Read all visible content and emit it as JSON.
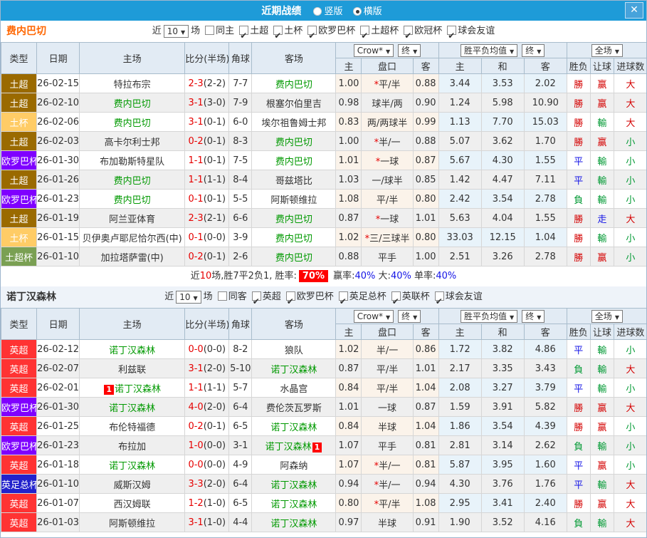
{
  "titlebar": {
    "title": "近期战绩",
    "radio_vertical": "竖版",
    "radio_horizontal": "横版",
    "close": "✕"
  },
  "col_headers": {
    "type": "类型",
    "date": "日期",
    "home": "主场",
    "score": "比分(半场)",
    "corner": "角球",
    "away": "客场",
    "crow": "Crow*",
    "final": "终",
    "avg": "胜平负均值",
    "full": "全场",
    "h": "主",
    "handicap": "盘口",
    "a": "客",
    "avg_h": "主",
    "avg_d": "和",
    "avg_a": "客",
    "wdl": "胜负",
    "let_ball": "让球",
    "goals": "进球数"
  },
  "type_colors": {
    "土超": "#9A6A00",
    "土杯": "#FFCC66",
    "欧罗巴杯": "#7F00FF",
    "土超杯": "#7AA053",
    "英超": "#FF3333",
    "英足总杯": "#2222CC"
  },
  "result_colors": {
    "勝": "red",
    "赢": "red",
    "大": "red",
    "平": "blue",
    "走": "blue",
    "負": "green",
    "輸": "green",
    "小": "green"
  },
  "accent": {
    "self_team": "#009900",
    "score": "#E60000",
    "titlebar": "#1E9BD8"
  },
  "sections": [
    {
      "team": "费内巴切",
      "team_color": "#FF6600",
      "filter": {
        "near": "近",
        "count": "10",
        "games": "场",
        "same": "同主",
        "same_checked": false,
        "leagues": [
          "土超",
          "土杯",
          "欧罗巴杯",
          "土超杯",
          "欧冠杯",
          "球会友谊"
        ]
      },
      "rows": [
        {
          "type": "土超",
          "date": "26-02-15",
          "home": "特拉布宗",
          "score": "2-3",
          "half": "(2-2)",
          "corner": "7-7",
          "away": "费内巴切",
          "away_self": true,
          "crow_h": "1.00",
          "handicap": "*平/半",
          "crow_a": "0.88",
          "avg_h": "3.44",
          "avg_d": "3.53",
          "avg_a": "2.02",
          "wdl": "勝",
          "let": "赢",
          "goal": "大"
        },
        {
          "type": "土超",
          "date": "26-02-10",
          "home": "费内巴切",
          "home_self": true,
          "score": "3-1",
          "half": "(3-0)",
          "corner": "7-9",
          "away": "根塞尔伯里吉",
          "crow_h": "0.98",
          "handicap": "球半/两",
          "crow_a": "0.90",
          "avg_h": "1.24",
          "avg_d": "5.98",
          "avg_a": "10.90",
          "wdl": "勝",
          "let": "赢",
          "goal": "大"
        },
        {
          "type": "土杯",
          "date": "26-02-06",
          "home": "费内巴切",
          "home_self": true,
          "score": "3-1",
          "half": "(0-1)",
          "corner": "6-0",
          "away": "埃尔祖鲁姆士邦",
          "crow_h": "0.83",
          "handicap": "两/两球半",
          "crow_a": "0.99",
          "avg_h": "1.13",
          "avg_d": "7.70",
          "avg_a": "15.03",
          "wdl": "勝",
          "let": "輸",
          "goal": "大"
        },
        {
          "type": "土超",
          "date": "26-02-03",
          "home": "高卡尔利士邦",
          "score": "0-2",
          "half": "(0-1)",
          "corner": "8-3",
          "away": "费内巴切",
          "away_self": true,
          "crow_h": "1.00",
          "handicap": "*半/一",
          "crow_a": "0.88",
          "avg_h": "5.07",
          "avg_d": "3.62",
          "avg_a": "1.70",
          "wdl": "勝",
          "let": "赢",
          "goal": "小"
        },
        {
          "type": "欧罗巴杯",
          "date": "26-01-30",
          "home": "布加勒斯特星队",
          "score": "1-1",
          "half": "(0-1)",
          "corner": "7-5",
          "away": "费内巴切",
          "away_self": true,
          "crow_h": "1.01",
          "handicap": "*一球",
          "crow_a": "0.87",
          "avg_h": "5.67",
          "avg_d": "4.30",
          "avg_a": "1.55",
          "wdl": "平",
          "let": "輸",
          "goal": "小"
        },
        {
          "type": "土超",
          "date": "26-01-26",
          "home": "费内巴切",
          "home_self": true,
          "score": "1-1",
          "half": "(1-1)",
          "corner": "8-4",
          "away": "哥兹塔比",
          "crow_h": "1.03",
          "handicap": "一/球半",
          "crow_a": "0.85",
          "avg_h": "1.42",
          "avg_d": "4.47",
          "avg_a": "7.11",
          "wdl": "平",
          "let": "輸",
          "goal": "小"
        },
        {
          "type": "欧罗巴杯",
          "date": "26-01-23",
          "home": "费内巴切",
          "home_self": true,
          "score": "0-1",
          "half": "(0-1)",
          "corner": "5-5",
          "away": "阿斯顿维拉",
          "crow_h": "1.08",
          "handicap": "平/半",
          "crow_a": "0.80",
          "avg_h": "2.42",
          "avg_d": "3.54",
          "avg_a": "2.78",
          "wdl": "負",
          "let": "輸",
          "goal": "小"
        },
        {
          "type": "土超",
          "date": "26-01-19",
          "home": "阿兰亚体育",
          "score": "2-3",
          "half": "(2-1)",
          "corner": "6-6",
          "away": "费内巴切",
          "away_self": true,
          "crow_h": "0.87",
          "handicap": "*一球",
          "crow_a": "1.01",
          "avg_h": "5.63",
          "avg_d": "4.04",
          "avg_a": "1.55",
          "wdl": "勝",
          "let": "走",
          "goal": "大"
        },
        {
          "type": "土杯",
          "date": "26-01-15",
          "home": "贝伊奥卢耶尼恰尔西(中)",
          "score": "0-1",
          "half": "(0-0)",
          "corner": "3-9",
          "away": "费内巴切",
          "away_self": true,
          "crow_h": "1.02",
          "handicap": "*三/三球半",
          "crow_a": "0.80",
          "avg_h": "33.03",
          "avg_d": "12.15",
          "avg_a": "1.04",
          "wdl": "勝",
          "let": "輸",
          "goal": "小"
        },
        {
          "type": "土超杯",
          "date": "26-01-10",
          "home": "加拉塔萨雷(中)",
          "score": "0-2",
          "half": "(0-1)",
          "corner": "2-6",
          "away": "费内巴切",
          "away_self": true,
          "crow_h": "0.88",
          "handicap": "平手",
          "crow_a": "1.00",
          "avg_h": "2.51",
          "avg_d": "3.26",
          "avg_a": "2.78",
          "wdl": "勝",
          "let": "赢",
          "goal": "小"
        }
      ],
      "summary": [
        {
          "text": "近"
        },
        {
          "text": "10",
          "cls": "red"
        },
        {
          "text": "场,胜7平2负1, 胜率:"
        },
        {
          "text": "70%",
          "cls": "pct-badge"
        },
        {
          "text": " 赢率:"
        },
        {
          "text": "40%",
          "cls": "blue"
        },
        {
          "text": " 大:"
        },
        {
          "text": "40%",
          "cls": "blue"
        },
        {
          "text": " 单率:"
        },
        {
          "text": "40%",
          "cls": "blue"
        }
      ]
    },
    {
      "team": "诺丁汉森林",
      "team_color": "#333333",
      "filter": {
        "near": "近",
        "count": "10",
        "games": "场",
        "same": "同客",
        "same_checked": false,
        "leagues": [
          "英超",
          "欧罗巴杯",
          "英足总杯",
          "英联杯",
          "球会友谊"
        ]
      },
      "rows": [
        {
          "type": "英超",
          "date": "26-02-12",
          "home": "诺丁汉森林",
          "home_self": true,
          "score": "0-0",
          "half": "(0-0)",
          "corner": "8-2",
          "away": "狼队",
          "crow_h": "1.02",
          "handicap": "半/一",
          "crow_a": "0.86",
          "avg_h": "1.72",
          "avg_d": "3.82",
          "avg_a": "4.86",
          "wdl": "平",
          "let": "輸",
          "goal": "小"
        },
        {
          "type": "英超",
          "date": "26-02-07",
          "home": "利兹联",
          "score": "3-1",
          "half": "(2-0)",
          "corner": "5-10",
          "away": "诺丁汉森林",
          "away_self": true,
          "crow_h": "0.87",
          "handicap": "平/半",
          "crow_a": "1.01",
          "avg_h": "2.17",
          "avg_d": "3.35",
          "avg_a": "3.43",
          "wdl": "負",
          "let": "輸",
          "goal": "大"
        },
        {
          "type": "英超",
          "date": "26-02-01",
          "home": "诺丁汉森林",
          "home_self": true,
          "home_badge": "1",
          "score": "1-1",
          "half": "(1-1)",
          "corner": "5-7",
          "away": "水晶宫",
          "crow_h": "0.84",
          "handicap": "平/半",
          "crow_a": "1.04",
          "avg_h": "2.08",
          "avg_d": "3.27",
          "avg_a": "3.79",
          "wdl": "平",
          "let": "輸",
          "goal": "小"
        },
        {
          "type": "欧罗巴杯",
          "date": "26-01-30",
          "home": "诺丁汉森林",
          "home_self": true,
          "score": "4-0",
          "half": "(2-0)",
          "corner": "6-4",
          "away": "费伦茨瓦罗斯",
          "crow_h": "1.01",
          "handicap": "一球",
          "crow_a": "0.87",
          "avg_h": "1.59",
          "avg_d": "3.91",
          "avg_a": "5.82",
          "wdl": "勝",
          "let": "赢",
          "goal": "大"
        },
        {
          "type": "英超",
          "date": "26-01-25",
          "home": "布伦特福德",
          "score": "0-2",
          "half": "(0-1)",
          "corner": "6-5",
          "away": "诺丁汉森林",
          "away_self": true,
          "crow_h": "0.84",
          "handicap": "半球",
          "crow_a": "1.04",
          "avg_h": "1.86",
          "avg_d": "3.54",
          "avg_a": "4.39",
          "wdl": "勝",
          "let": "赢",
          "goal": "小"
        },
        {
          "type": "欧罗巴杯",
          "date": "26-01-23",
          "home": "布拉加",
          "score": "1-0",
          "half": "(0-0)",
          "corner": "3-1",
          "away": "诺丁汉森林",
          "away_self": true,
          "away_badge": "1",
          "crow_h": "1.07",
          "handicap": "平手",
          "crow_a": "0.81",
          "avg_h": "2.81",
          "avg_d": "3.14",
          "avg_a": "2.62",
          "wdl": "負",
          "let": "輸",
          "goal": "小"
        },
        {
          "type": "英超",
          "date": "26-01-18",
          "home": "诺丁汉森林",
          "home_self": true,
          "score": "0-0",
          "half": "(0-0)",
          "corner": "4-9",
          "away": "阿森纳",
          "crow_h": "1.07",
          "handicap": "*半/一",
          "crow_a": "0.81",
          "avg_h": "5.87",
          "avg_d": "3.95",
          "avg_a": "1.60",
          "wdl": "平",
          "let": "赢",
          "goal": "小"
        },
        {
          "type": "英足总杯",
          "date": "26-01-10",
          "home": "威斯汉姆",
          "score": "3-3",
          "half": "(2-0)",
          "corner": "6-4",
          "away": "诺丁汉森林",
          "away_self": true,
          "crow_h": "0.94",
          "handicap": "*半/一",
          "crow_a": "0.94",
          "avg_h": "4.30",
          "avg_d": "3.76",
          "avg_a": "1.76",
          "wdl": "平",
          "let": "輸",
          "goal": "大"
        },
        {
          "type": "英超",
          "date": "26-01-07",
          "home": "西汉姆联",
          "score": "1-2",
          "half": "(1-0)",
          "corner": "6-5",
          "away": "诺丁汉森林",
          "away_self": true,
          "crow_h": "0.80",
          "handicap": "*平/半",
          "crow_a": "1.08",
          "avg_h": "2.95",
          "avg_d": "3.41",
          "avg_a": "2.40",
          "wdl": "勝",
          "let": "赢",
          "goal": "大"
        },
        {
          "type": "英超",
          "date": "26-01-03",
          "home": "阿斯顿维拉",
          "score": "3-1",
          "half": "(1-0)",
          "corner": "4-4",
          "away": "诺丁汉森林",
          "away_self": true,
          "crow_h": "0.97",
          "handicap": "半球",
          "crow_a": "0.91",
          "avg_h": "1.90",
          "avg_d": "3.52",
          "avg_a": "4.16",
          "wdl": "負",
          "let": "輸",
          "goal": "大"
        }
      ],
      "summary": null
    }
  ]
}
